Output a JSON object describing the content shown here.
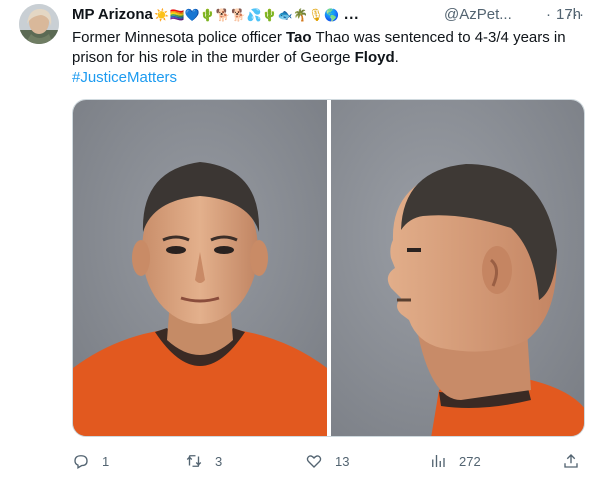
{
  "tweet": {
    "author_name": "MP Arizona",
    "author_emojis": "☀️🏳️‍🌈💙🌵🐕🐕💦🌵🐟🌴🎙🌎",
    "ellipsis": "...",
    "handle": "@AzPet...",
    "separator": "·",
    "time": "17h",
    "more_label": "···",
    "text": {
      "part1": "Former Minnesota police officer  ",
      "bold1": "Tao",
      "part2": " Thao was sentenced to 4-3/4 years in prison for his role in the murder of George ",
      "bold2": "Floyd",
      "part3": ".",
      "hashtag": "#JusticeMatters"
    },
    "actions": {
      "replies": "1",
      "retweets": "3",
      "likes": "13",
      "views": "272"
    },
    "colors": {
      "link": "#1d9bf0",
      "secondary_text": "#536471",
      "orange_uniform": "#e2591f",
      "photo_background": "#868990"
    }
  }
}
